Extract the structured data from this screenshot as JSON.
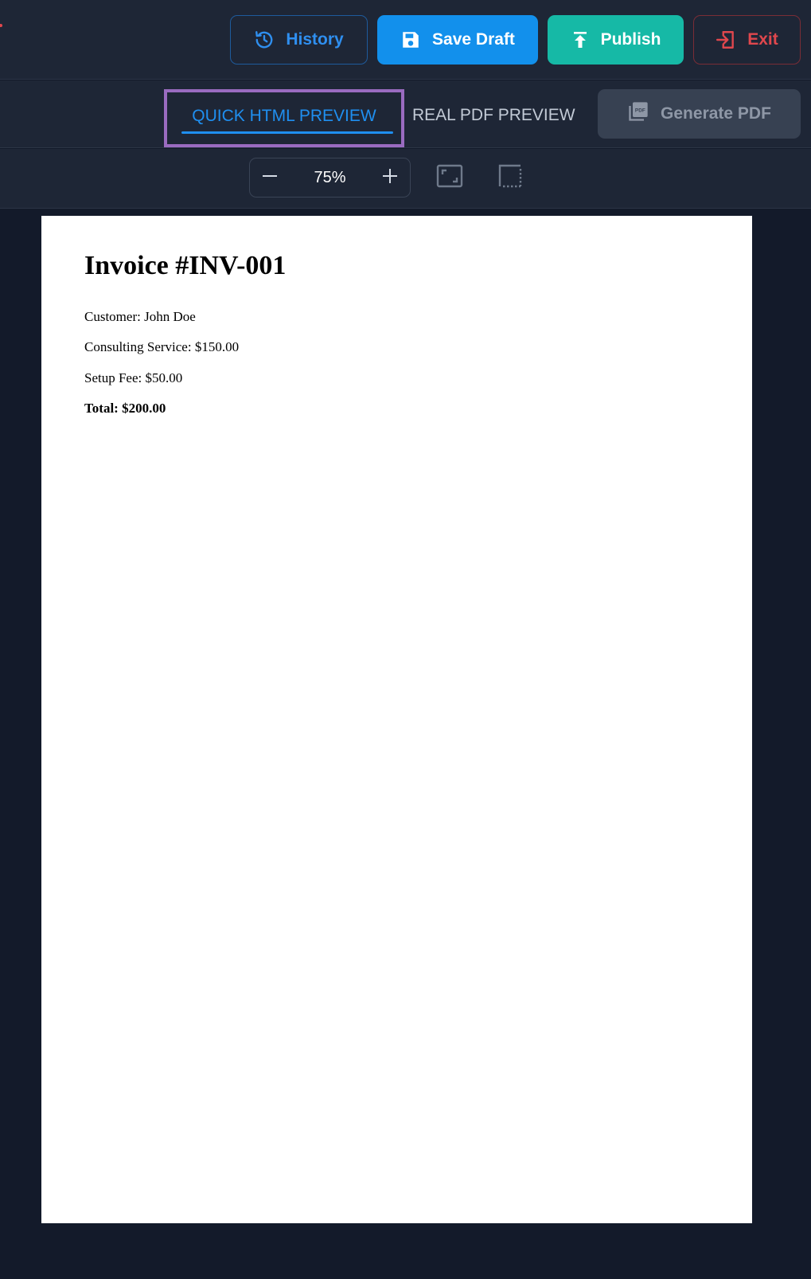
{
  "toolbar": {
    "history_label": "History",
    "save_draft_label": "Save Draft",
    "publish_label": "Publish",
    "exit_label": "Exit"
  },
  "tabs": {
    "quick_preview_label": "QUICK HTML PREVIEW",
    "real_preview_label": "REAL PDF PREVIEW",
    "active": "QUICK HTML PREVIEW",
    "generate_pdf_label": "Generate PDF"
  },
  "zoom": {
    "value": "75%"
  },
  "document": {
    "title": "Invoice #INV-001",
    "customer": "Customer: John Doe",
    "consulting": "Consulting Service: $150.00",
    "setup_fee": "Setup Fee: $50.00",
    "total": "Total: $200.00"
  },
  "colors": {
    "accent_blue": "#1290ec",
    "publish_teal": "#16b9a6",
    "exit_red": "#e0474d",
    "highlight_purple": "#9a6bc0",
    "panel_bg": "#1e2636",
    "canvas_bg": "#131a2a"
  },
  "icons": {
    "history": "history-icon",
    "save": "floppy-disk-icon",
    "publish": "upload-icon",
    "exit": "exit-icon",
    "generate_pdf": "pdf-stack-icon",
    "zoom_out": "minus-icon",
    "zoom_in": "plus-icon",
    "fit_page": "fit-page-icon",
    "fit_width": "fit-width-icon"
  }
}
